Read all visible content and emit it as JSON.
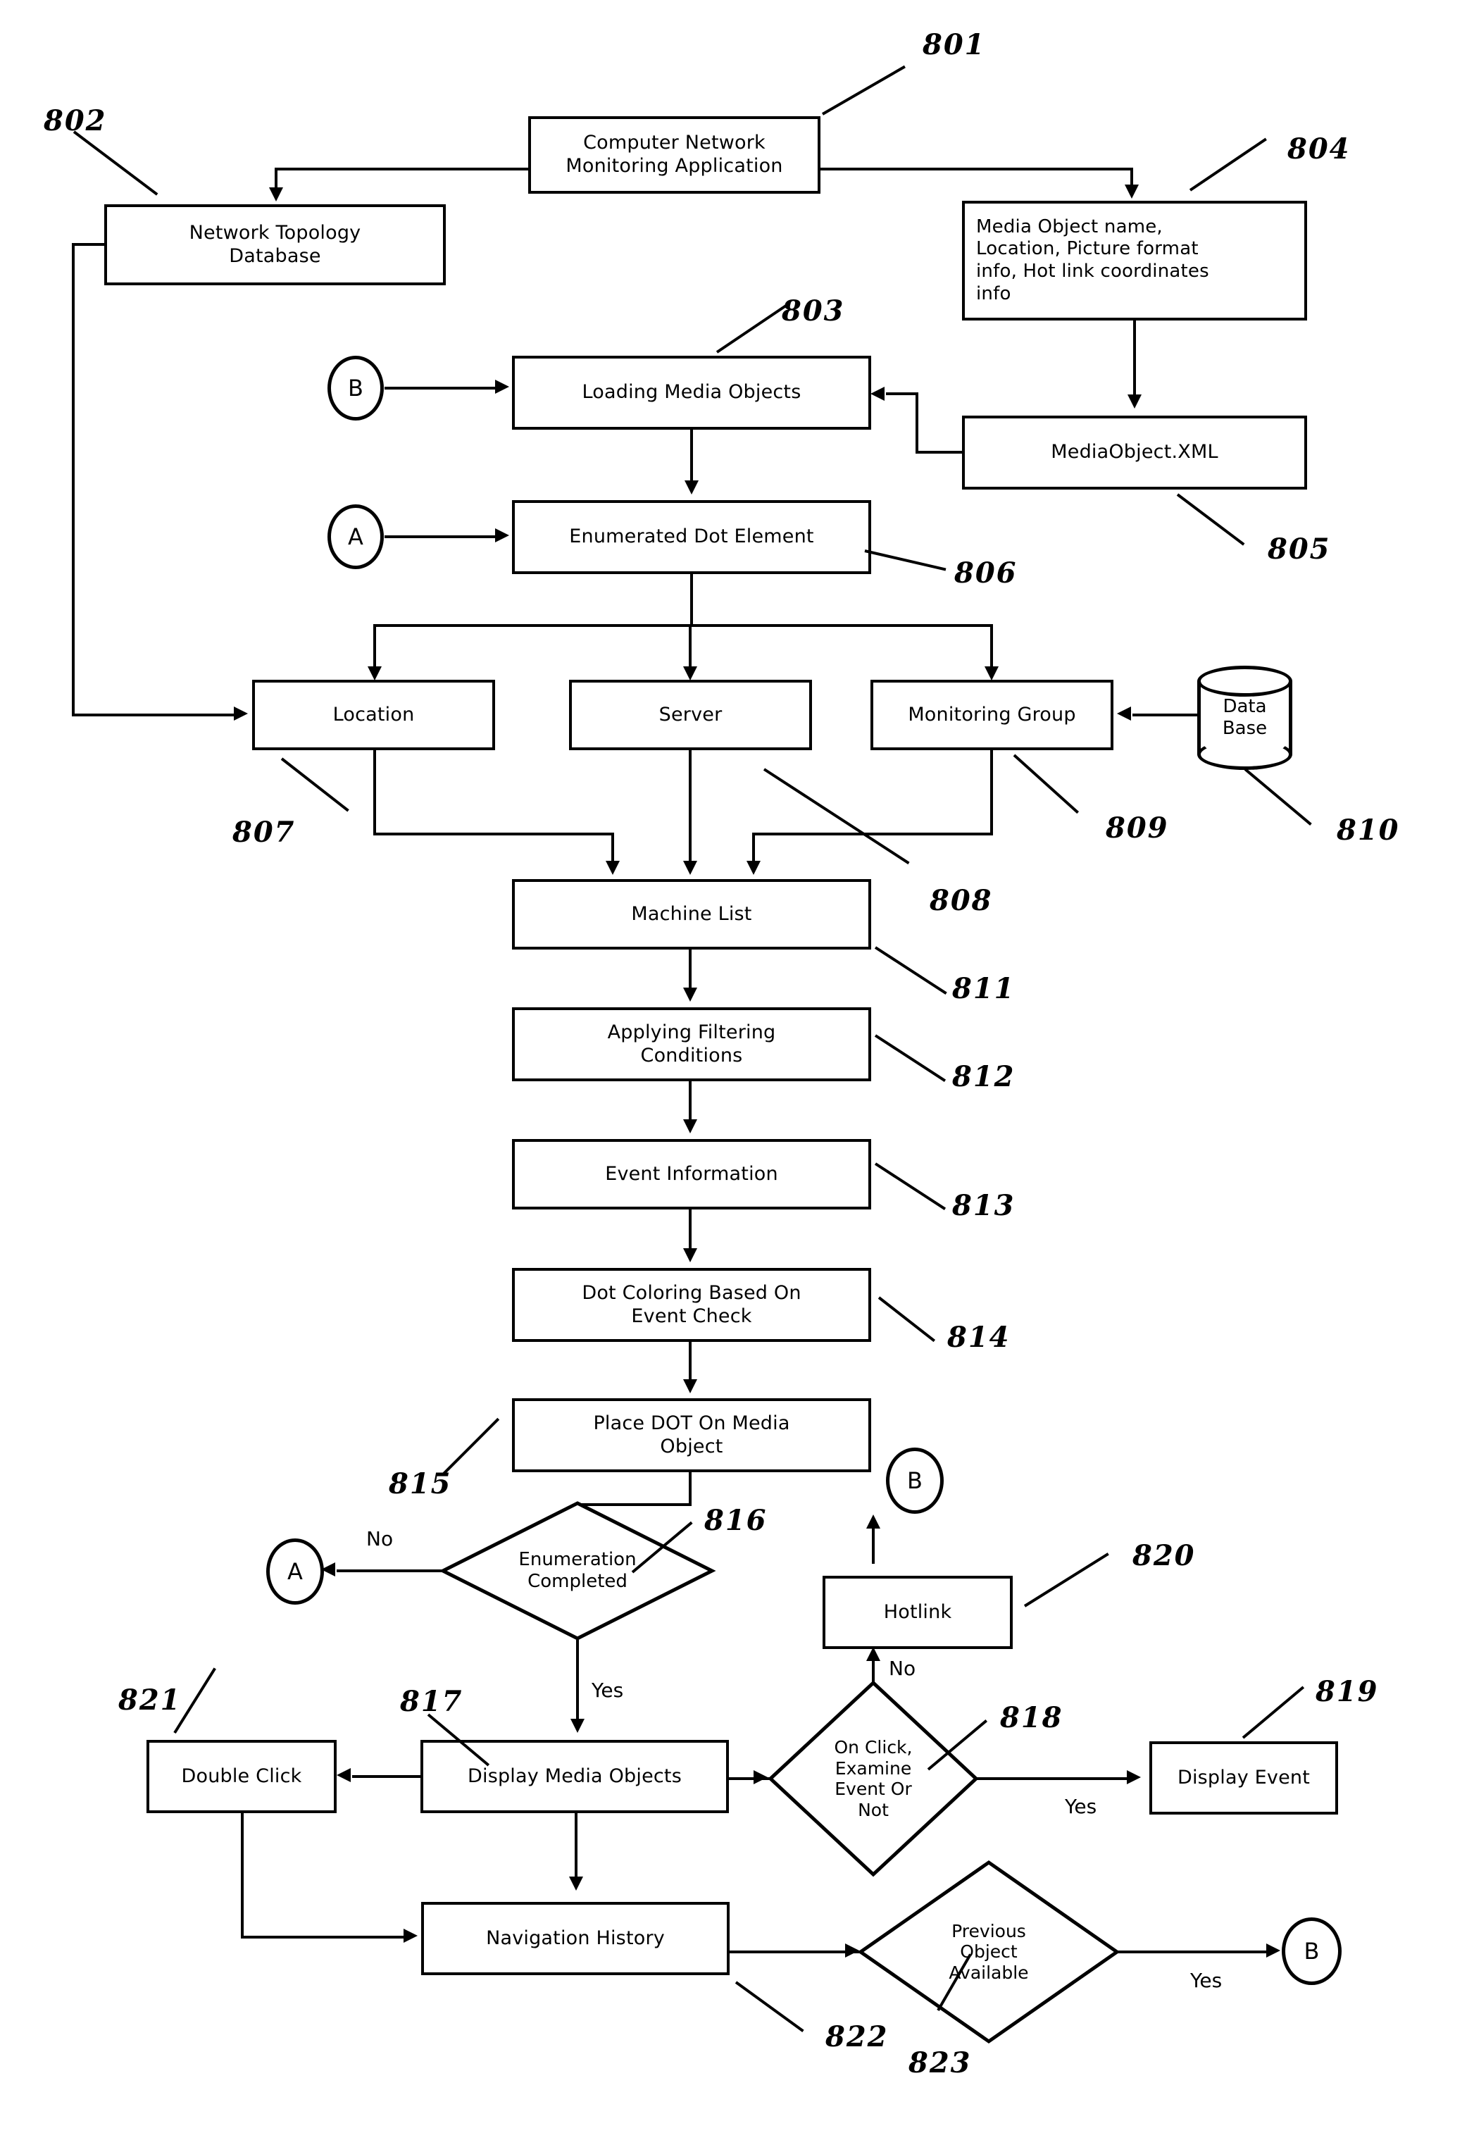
{
  "figure": {
    "kind": "patent-flowchart",
    "title": "Computer Network Monitoring Application flow"
  },
  "nodes": {
    "n801": "Computer Network\nMonitoring Application",
    "n802": "Network Topology\nDatabase",
    "n804": "Media Object name, Location, Picture format info, Hot link coordinates info",
    "n805": "MediaObject.XML",
    "n803": "Loading Media Objects",
    "n806": "Enumerated Dot Element",
    "n807": "Location",
    "n808": "Server",
    "n809": "Monitoring Group",
    "n810": "Data\nBase",
    "n811": "Machine List",
    "n812": "Applying Filtering\nConditions",
    "n813": "Event Information",
    "n814": "Dot Coloring Based On\nEvent Check",
    "n815": "Place DOT On Media\nObject",
    "n816": "Enumeration\nCompleted",
    "n817": "Display Media Objects",
    "n818": "On Click,\nExamine\nEvent Or\nNot",
    "n819": "Display Event",
    "n820": "Hotlink",
    "n821": "Double Click",
    "n822": "Navigation History",
    "n823": "Previous\nObject\nAvailable"
  },
  "node_lines": {
    "n801_l1": "Computer Network",
    "n801_l2": "Monitoring Application",
    "n802_l1": "Network Topology",
    "n802_l2": "Database",
    "n804_l1": "Media Object name,",
    "n804_l2": "Location, Picture format",
    "n804_l3": "info, Hot link coordinates",
    "n804_l4": "info",
    "n810_l1": "Data",
    "n810_l2": "Base",
    "n812_l1": "Applying Filtering",
    "n812_l2": "Conditions",
    "n814_l1": "Dot Coloring Based On",
    "n814_l2": "Event Check",
    "n815_l1": "Place DOT On Media",
    "n815_l2": "Object",
    "n816_l1": "Enumeration",
    "n816_l2": "Completed",
    "n818_l1": "On Click,",
    "n818_l2": "Examine",
    "n818_l3": "Event Or",
    "n818_l4": "Not",
    "n823_l1": "Previous",
    "n823_l2": "Object",
    "n823_l3": "Available"
  },
  "connectors": {
    "b_top": "B",
    "a_mid": "A",
    "a_bottom": "A",
    "b_hotlink": "B",
    "b_prev": "B"
  },
  "edge_labels": {
    "enum_no": "No",
    "enum_yes": "Yes",
    "click_no": "No",
    "click_yes": "Yes",
    "prev_yes": "Yes"
  },
  "reference_numerals": {
    "r801": "801",
    "r802": "802",
    "r803": "803",
    "r804": "804",
    "r805": "805",
    "r806": "806",
    "r807": "807",
    "r808": "808",
    "r809": "809",
    "r810": "810",
    "r811": "811",
    "r812": "812",
    "r813": "813",
    "r814": "814",
    "r815": "815",
    "r816": "816",
    "r817": "817",
    "r818": "818",
    "r819": "819",
    "r820": "820",
    "r821": "821",
    "r822": "822",
    "r823": "823"
  },
  "colors": {
    "ink": "#000000",
    "paper": "#ffffff"
  }
}
